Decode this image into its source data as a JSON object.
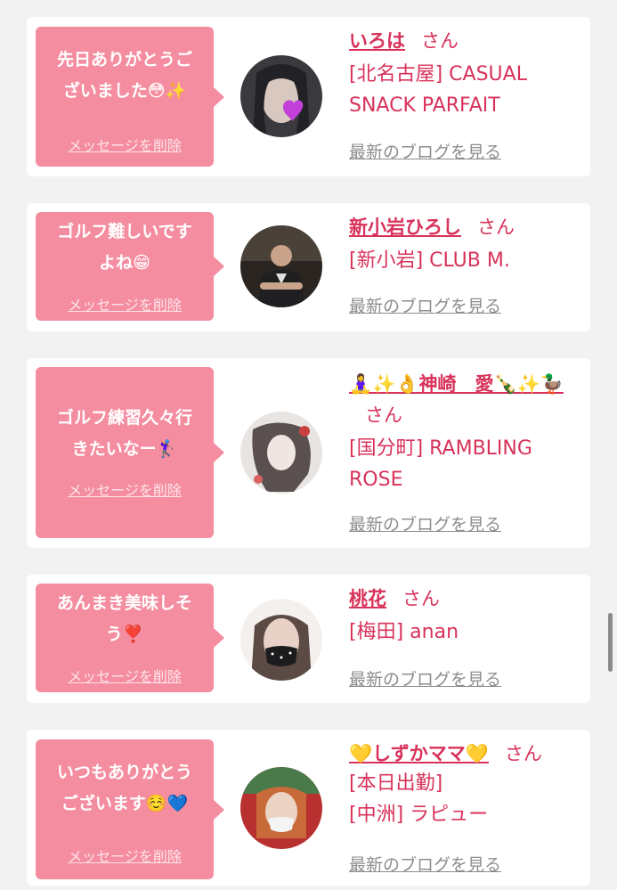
{
  "colors": {
    "background": "#f2f2f2",
    "bubble": "#f58da0",
    "accent": "#d8325a",
    "link_gray": "#8d8d8d"
  },
  "delete_label": "メッセージを削除",
  "blog_label": "最新のブログを見る",
  "honorific": "さん",
  "cards": [
    {
      "message": "先日ありがとうご\nざいました😳✨",
      "name": "いろは",
      "details": [
        "[北名古屋] CASUAL SNACK PARFAIT"
      ],
      "avatar_icon": "woman-with-purple-heart-avatar"
    },
    {
      "message": "ゴルフ難しいです\nよね😁",
      "name": "新小岩ひろし",
      "details": [
        "[新小岩] CLUB M."
      ],
      "avatar_icon": "man-in-suit-avatar"
    },
    {
      "message": "ゴルフ練習久々行\nきたいなー🏌️‍♀️",
      "name": "🧘‍♀️✨👌神崎　愛🍾✨🦆",
      "details": [
        "[国分町] RAMBLING ROSE"
      ],
      "avatar_icon": "woman-black-white-avatar"
    },
    {
      "message": "あんまき美味しそ\nう❣️",
      "name": "桃花",
      "details": [
        "[梅田] anan"
      ],
      "avatar_icon": "woman-with-mask-avatar"
    },
    {
      "message": "いつもありがとう\nございます☺️💙",
      "name": "💛しずかママ💛",
      "details": [
        "[本日出勤]",
        "[中洲] ラピュー"
      ],
      "avatar_icon": "woman-at-stadium-avatar"
    }
  ]
}
